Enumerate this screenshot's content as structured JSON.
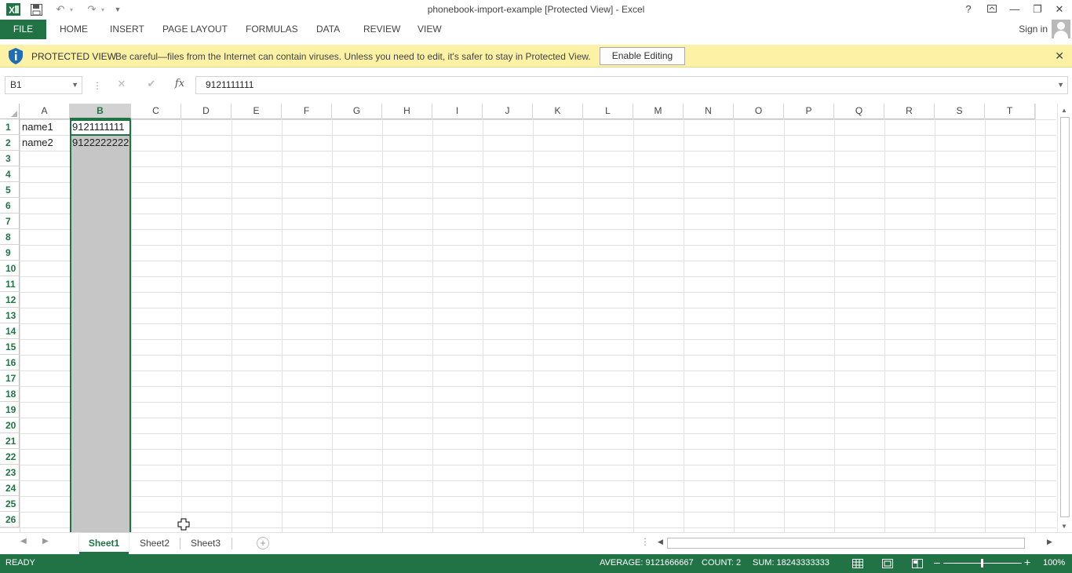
{
  "window": {
    "title": "phonebook-import-example  [Protected View] - Excel",
    "help": "?",
    "minimize": "—",
    "restore": "❐",
    "close": "✕"
  },
  "ribbon": {
    "file": "FILE",
    "tabs": [
      "HOME",
      "INSERT",
      "PAGE LAYOUT",
      "FORMULAS",
      "DATA",
      "REVIEW",
      "VIEW"
    ],
    "signin": "Sign in"
  },
  "protected_view": {
    "title": "PROTECTED VIEW",
    "message": "Be careful—files from the Internet can contain viruses. Unless you need to edit, it's safer to stay in Protected View.",
    "enable_button": "Enable Editing",
    "close": "✕"
  },
  "formula_bar": {
    "name_box": "B1",
    "fx": "fx",
    "cancel": "✕",
    "enter": "✔",
    "content": "9121111111"
  },
  "grid": {
    "columns": [
      "A",
      "B",
      "C",
      "D",
      "E",
      "F",
      "G",
      "H",
      "I",
      "J",
      "K",
      "L",
      "M",
      "N",
      "O",
      "P",
      "Q",
      "R",
      "S",
      "T"
    ],
    "selected_column": "B",
    "rows": [
      "1",
      "2",
      "3",
      "4",
      "5",
      "6",
      "7",
      "8",
      "9",
      "10",
      "11",
      "12",
      "13",
      "14",
      "15",
      "16",
      "17",
      "18",
      "19",
      "20",
      "21",
      "22",
      "23",
      "24",
      "25",
      "26"
    ],
    "cells": [
      {
        "ref": "A1",
        "value": "name1"
      },
      {
        "ref": "B1",
        "value": "9121111111"
      },
      {
        "ref": "A2",
        "value": "name2"
      },
      {
        "ref": "B2",
        "value": "9122222222"
      }
    ]
  },
  "sheets": {
    "tabs": [
      "Sheet1",
      "Sheet2",
      "Sheet3"
    ],
    "active": "Sheet1"
  },
  "status": {
    "state": "READY",
    "average": "AVERAGE: 9121666667",
    "count": "COUNT: 2",
    "sum": "SUM: 18243333333",
    "zoom": "100%"
  },
  "colors": {
    "excel_green": "#217346",
    "protected_bar": "#fdf1a6",
    "selection_gray": "#c6c6c6"
  }
}
